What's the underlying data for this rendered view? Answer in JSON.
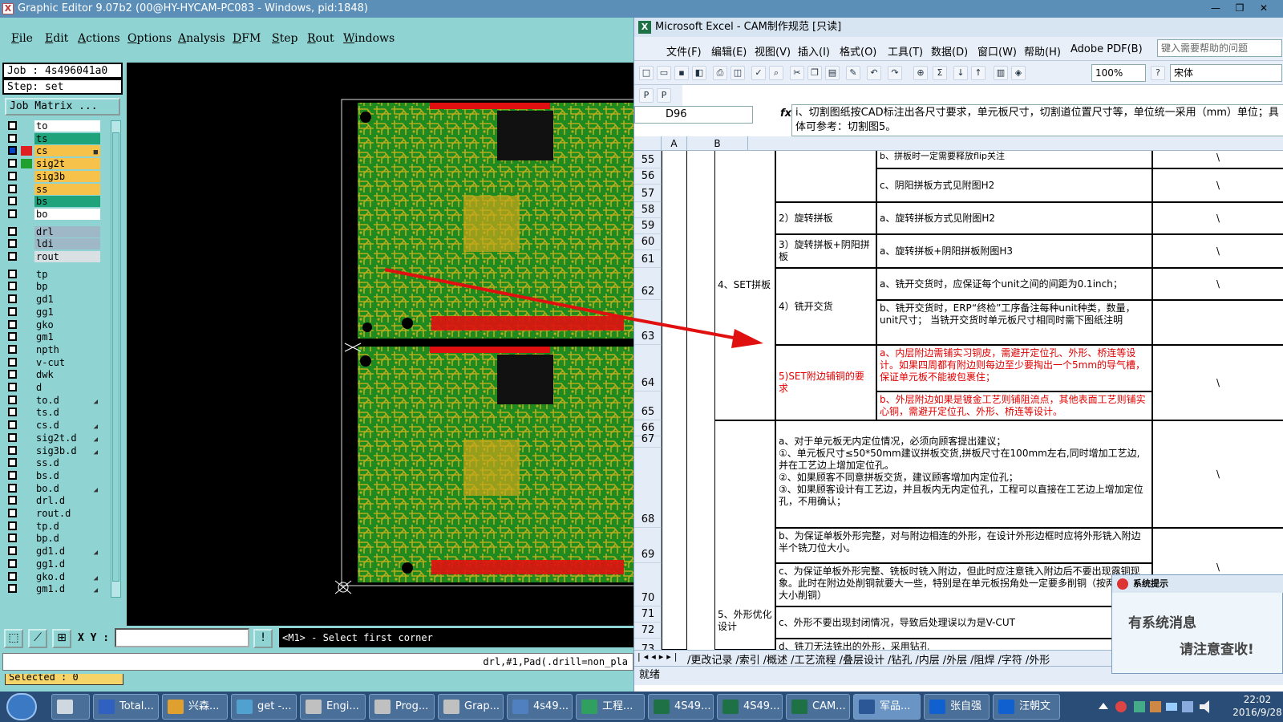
{
  "ge": {
    "title": "Graphic Editor 9.07b2 (00@HY-HYCAM-PC083 - Windows, pid:1848)",
    "menu": [
      "File",
      "Edit",
      "Actions",
      "Options",
      "Analysis",
      "DFM",
      "Step",
      "Rout",
      "Windows"
    ],
    "job": "Job : 4s496041a0",
    "step": "Step: set",
    "job_matrix": "Job Matrix ...",
    "layers": [
      {
        "name": "to",
        "color": "#ffffff",
        "swatch": "",
        "checked": false,
        "mark": ""
      },
      {
        "name": "ts",
        "color": "#1fa37a",
        "swatch": "",
        "checked": false,
        "mark": ""
      },
      {
        "name": "cs",
        "color": "#f7c24a",
        "swatch": "#e02020",
        "checked": true,
        "mark": "■"
      },
      {
        "name": "sig2t",
        "color": "#f7c24a",
        "swatch": "#1fa030",
        "checked": false,
        "mark": ""
      },
      {
        "name": "sig3b",
        "color": "#f7c24a",
        "swatch": "",
        "checked": false,
        "mark": ""
      },
      {
        "name": "ss",
        "color": "#f7c24a",
        "swatch": "",
        "checked": false,
        "mark": ""
      },
      {
        "name": "bs",
        "color": "#1fa37a",
        "swatch": "",
        "checked": false,
        "mark": ""
      },
      {
        "name": "bo",
        "color": "#ffffff",
        "swatch": "",
        "checked": false,
        "mark": ""
      },
      {
        "name": "drl",
        "color": "#9fb8c8",
        "swatch": "",
        "checked": false,
        "mark": ""
      },
      {
        "name": "ldi",
        "color": "#9fb8c8",
        "swatch": "",
        "checked": false,
        "mark": ""
      },
      {
        "name": "rout",
        "color": "#d8e0e4",
        "swatch": "",
        "checked": false,
        "mark": ""
      },
      {
        "name": "tp",
        "color": "#8fd3d3",
        "swatch": "",
        "checked": false,
        "mark": ""
      },
      {
        "name": "bp",
        "color": "#8fd3d3",
        "swatch": "",
        "checked": false,
        "mark": ""
      },
      {
        "name": "gd1",
        "color": "#8fd3d3",
        "swatch": "",
        "checked": false,
        "mark": ""
      },
      {
        "name": "gg1",
        "color": "#8fd3d3",
        "swatch": "",
        "checked": false,
        "mark": ""
      },
      {
        "name": "gko",
        "color": "#8fd3d3",
        "swatch": "",
        "checked": false,
        "mark": ""
      },
      {
        "name": "gm1",
        "color": "#8fd3d3",
        "swatch": "",
        "checked": false,
        "mark": ""
      },
      {
        "name": "npth",
        "color": "#8fd3d3",
        "swatch": "",
        "checked": false,
        "mark": ""
      },
      {
        "name": "v-cut",
        "color": "#8fd3d3",
        "swatch": "",
        "checked": false,
        "mark": ""
      },
      {
        "name": "dwk",
        "color": "#8fd3d3",
        "swatch": "",
        "checked": false,
        "mark": ""
      },
      {
        "name": "d",
        "color": "#8fd3d3",
        "swatch": "",
        "checked": false,
        "mark": ""
      },
      {
        "name": "to.d",
        "color": "#8fd3d3",
        "swatch": "",
        "checked": false,
        "mark": "◢"
      },
      {
        "name": "ts.d",
        "color": "#8fd3d3",
        "swatch": "",
        "checked": false,
        "mark": ""
      },
      {
        "name": "cs.d",
        "color": "#8fd3d3",
        "swatch": "",
        "checked": false,
        "mark": "◢"
      },
      {
        "name": "sig2t.d",
        "color": "#8fd3d3",
        "swatch": "",
        "checked": false,
        "mark": "◢"
      },
      {
        "name": "sig3b.d",
        "color": "#8fd3d3",
        "swatch": "",
        "checked": false,
        "mark": "◢"
      },
      {
        "name": "ss.d",
        "color": "#8fd3d3",
        "swatch": "",
        "checked": false,
        "mark": ""
      },
      {
        "name": "bs.d",
        "color": "#8fd3d3",
        "swatch": "",
        "checked": false,
        "mark": ""
      },
      {
        "name": "bo.d",
        "color": "#8fd3d3",
        "swatch": "",
        "checked": false,
        "mark": "◢"
      },
      {
        "name": "drl.d",
        "color": "#8fd3d3",
        "swatch": "",
        "checked": false,
        "mark": ""
      },
      {
        "name": "rout.d",
        "color": "#8fd3d3",
        "swatch": "",
        "checked": false,
        "mark": ""
      },
      {
        "name": "tp.d",
        "color": "#8fd3d3",
        "swatch": "",
        "checked": false,
        "mark": ""
      },
      {
        "name": "bp.d",
        "color": "#8fd3d3",
        "swatch": "",
        "checked": false,
        "mark": ""
      },
      {
        "name": "gd1.d",
        "color": "#8fd3d3",
        "swatch": "",
        "checked": false,
        "mark": "◢"
      },
      {
        "name": "gg1.d",
        "color": "#8fd3d3",
        "swatch": "",
        "checked": false,
        "mark": ""
      },
      {
        "name": "gko.d",
        "color": "#8fd3d3",
        "swatch": "",
        "checked": false,
        "mark": "◢"
      },
      {
        "name": "gm1.d",
        "color": "#8fd3d3",
        "swatch": "",
        "checked": false,
        "mark": "◢"
      }
    ],
    "selected": "Selected : 0",
    "xy_label": "X Y :",
    "xy_value": "",
    "prompt": "<M1> - Select first corner",
    "status": "drl,#1,Pad(.drill=non_pla",
    "colors": {
      "board": "#1f8a1f",
      "trace": "#d4b21c",
      "pad": "#e01010",
      "arrow": "#e01010"
    }
  },
  "xl": {
    "title": "Microsoft Excel - CAM制作规范 [只读]",
    "menu": [
      "文件(F)",
      "编辑(E)",
      "视图(V)",
      "插入(I)",
      "格式(O)",
      "工具(T)",
      "数据(D)",
      "窗口(W)",
      "帮助(H)",
      "Adobe PDF(B)"
    ],
    "help_placeholder": "键入需要帮助的问题",
    "zoom": "100%",
    "font": "宋体",
    "name_box": "D96",
    "fx": "fx",
    "formula": "i、切割图纸按CAD标注出各尺寸要求，单元板尺寸，切割道位置尺寸等，单位统一采用（mm）单位；具体可参考：切割图5。",
    "col_a": "A",
    "col_b": "B",
    "rows": [
      "55",
      "56",
      "57",
      "58",
      "59",
      "60",
      "61",
      "62",
      "63",
      "64",
      "65",
      "66",
      "67",
      "68",
      "69",
      "70",
      "71",
      "72",
      "73"
    ],
    "cells": {
      "r55_text": "b、拼板时一定需要释放flip关注",
      "r56_c": "c、阴阳拼板方式见附图H2",
      "r56_d": "\\",
      "r58_b": "2）旋转拼板",
      "r58_c": "a、旋转拼板方式见附图H2",
      "r58_d": "\\",
      "set_label": "4、SET拼板",
      "r60_b": "3）旋转拼板+阴阳拼板",
      "r60_c": "a、旋转拼板+阴阳拼板附图H3",
      "r60_d": "\\",
      "r62_b": "4）铣开交货",
      "r62_c1": "a、铣开交货时，应保证每个unit之间的间距为0.1inch；",
      "r62_d": "\\",
      "r62_c2": "b、铣开交货时，ERP“终检”工序备注每种unit种类，数量，unit尺寸；  当铣开交货时单元板尺寸相同时需下图纸注明",
      "r64_b": "5)SET附边铺铜的要求",
      "r64_c1": "a、内层附边需铺实习铜皮，需避开定位孔、外形、桥连等设计。如果四周都有附边则每边至少要掏出一个5mm的导气槽，保证单元板不能被包裹住；",
      "r64_d": "\\",
      "r64_c2": "b、外层附边如果是镀金工艺则铺阻流点，其他表面工艺则铺实心铜，需避开定位孔、外形、桥连等设计。",
      "r68_c": "a、对于单元板无内定位情况，必须向顾客提出建议；\n①、单元板尺寸≤50*50mm建议拼板交货,拼板尺寸在100mm左右,同时增加工艺边,并在工艺边上增加定位孔。\n②、如果顾客不同意拼板交货，建议顾客增加内定位孔；\n③、如果顾客设计有工艺边，并且板内无内定位孔，工程可以直接在工艺边上增加定位孔，不用确认；",
      "r68_d": "\\",
      "r69_c": "b、为保证单板外形完整，对与附边相连的外形，在设计外形边框时应将外形铣入附边半个铣刀位大小。",
      "r70_c": "c、为保证单板外形完整、铣板时铣入附边，但此时应注意铣入附边后不要出现露铜现象。此时在附边处削铜就要大一些，特别是在单元板拐角处一定要多削铜（按两倍铣刀大小削铜）",
      "r70_d": "\\",
      "shape_label": "5、外形优化设计",
      "r72_c": "c、外形不要出现封闭情况，导致后处理误以为是V-CUT",
      "r73_c": "d、铣刀无法铣出的外形，采用钻孔"
    },
    "sheet_tabs": [
      "更改记录",
      "索引",
      "概述",
      "工艺流程",
      "叠层设计",
      "钻孔",
      "内层",
      "外层",
      "阻焊",
      "字符",
      "外形"
    ],
    "status": "就绪",
    "caption_min": "—",
    "caption_max": "❐",
    "caption_close": "✕"
  },
  "popup": {
    "title": "系统提示",
    "line1": "有系统消息",
    "line2": "请注意查收!"
  },
  "taskbar": {
    "tasks": [
      {
        "label": "",
        "color": "#cfd8e0"
      },
      {
        "label": "Total...",
        "color": "#3060c0"
      },
      {
        "label": "兴森...",
        "color": "#e0a030"
      },
      {
        "label": "get -...",
        "color": "#50a0d0"
      },
      {
        "label": "Engi...",
        "color": "#c0c0c0"
      },
      {
        "label": "Prog...",
        "color": "#c0c0c0"
      },
      {
        "label": "Grap...",
        "color": "#c0c0c0"
      },
      {
        "label": "4s49...",
        "color": "#5080c0"
      },
      {
        "label": "工程...",
        "color": "#30a060"
      },
      {
        "label": "4S49...",
        "color": "#1e7145"
      },
      {
        "label": "4S49...",
        "color": "#1e7145"
      },
      {
        "label": "CAM...",
        "color": "#1e7145"
      },
      {
        "label": "军品...",
        "color": "#2b5797"
      },
      {
        "label": "张自强",
        "color": "#1060d0"
      },
      {
        "label": "汪朝文",
        "color": "#1060d0"
      }
    ],
    "time": "22:02",
    "date": "2016/9/28"
  }
}
